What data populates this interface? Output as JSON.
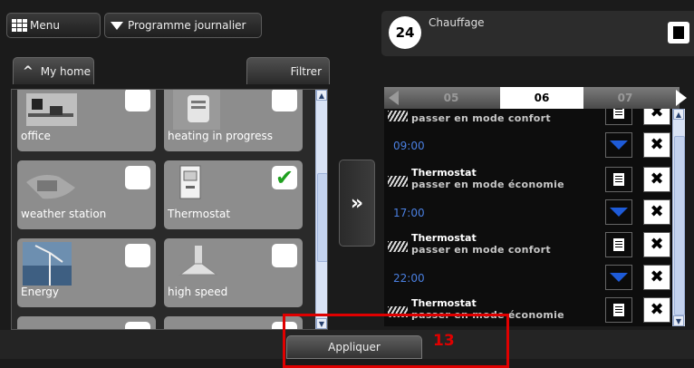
{
  "topbar": {
    "menu_label": "Menu",
    "programme_label": "Programme journalier"
  },
  "heating": {
    "badge": "24",
    "title": "Chauffage"
  },
  "left": {
    "home_label": "My home",
    "filter_label": "Filtrer",
    "tiles": [
      {
        "label": "office",
        "checked": false
      },
      {
        "label": "heating in progress",
        "checked": false
      },
      {
        "label": "weather station",
        "checked": false
      },
      {
        "label": "Thermostat",
        "checked": true
      },
      {
        "label": "Energy",
        "checked": false
      },
      {
        "label": "high speed",
        "checked": false
      }
    ]
  },
  "move_button": "»",
  "days": {
    "prev": "05",
    "current": "06",
    "next": "07"
  },
  "schedule": {
    "entries": [
      {
        "title": "",
        "action": "passer en mode confort"
      },
      {
        "time": "09:00"
      },
      {
        "title": "Thermostat",
        "action": "passer en mode économie"
      },
      {
        "time": "17:00"
      },
      {
        "title": "Thermostat",
        "action": "passer en mode confort"
      },
      {
        "time": "22:00"
      },
      {
        "title": "Thermostat",
        "action": "passer en mode économie"
      }
    ]
  },
  "apply_label": "Appliquer",
  "annotation": {
    "label": "13",
    "color": "#e00000"
  },
  "colors": {
    "time_blue": "#4a7fe0",
    "check_green": "#1fa01f",
    "accent_down": "#1e5bd8"
  }
}
